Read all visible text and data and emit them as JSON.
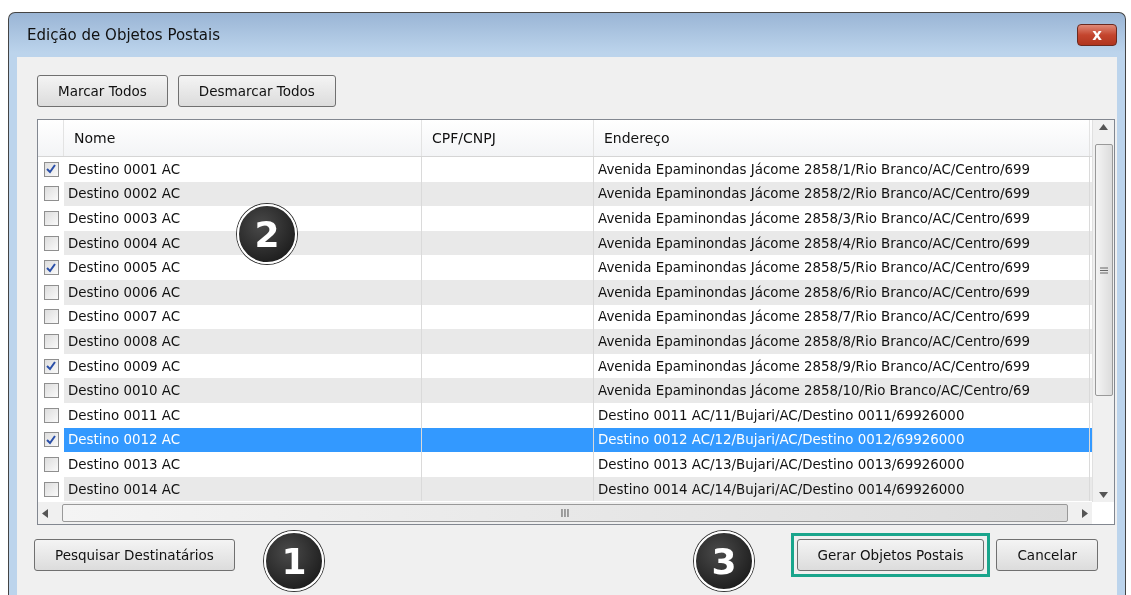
{
  "window": {
    "title": "Edição de Objetos Postais",
    "close_label": "x"
  },
  "top_buttons": [
    "Marcar Todos",
    "Desmarcar Todos"
  ],
  "table": {
    "columns": [
      "Nome",
      "CPF/CNPJ",
      "Endereço"
    ],
    "rows": [
      {
        "checked": true,
        "selected": false,
        "nome": "Destino 0001 AC",
        "cpf": "",
        "endereco": "Avenida Epaminondas Jácome 2858/1/Rio Branco/AC/Centro/699"
      },
      {
        "checked": false,
        "selected": false,
        "nome": "Destino 0002 AC",
        "cpf": "",
        "endereco": "Avenida Epaminondas Jácome 2858/2/Rio Branco/AC/Centro/699"
      },
      {
        "checked": false,
        "selected": false,
        "nome": "Destino 0003 AC",
        "cpf": "",
        "endereco": "Avenida Epaminondas Jácome 2858/3/Rio Branco/AC/Centro/699"
      },
      {
        "checked": false,
        "selected": false,
        "nome": "Destino 0004 AC",
        "cpf": "",
        "endereco": "Avenida Epaminondas Jácome 2858/4/Rio Branco/AC/Centro/699"
      },
      {
        "checked": true,
        "selected": false,
        "nome": "Destino 0005 AC",
        "cpf": "",
        "endereco": "Avenida Epaminondas Jácome 2858/5/Rio Branco/AC/Centro/699"
      },
      {
        "checked": false,
        "selected": false,
        "nome": "Destino 0006 AC",
        "cpf": "",
        "endereco": "Avenida Epaminondas Jácome 2858/6/Rio Branco/AC/Centro/699"
      },
      {
        "checked": false,
        "selected": false,
        "nome": "Destino 0007 AC",
        "cpf": "",
        "endereco": "Avenida Epaminondas Jácome 2858/7/Rio Branco/AC/Centro/699"
      },
      {
        "checked": false,
        "selected": false,
        "nome": "Destino 0008 AC",
        "cpf": "",
        "endereco": "Avenida Epaminondas Jácome 2858/8/Rio Branco/AC/Centro/699"
      },
      {
        "checked": true,
        "selected": false,
        "nome": "Destino 0009 AC",
        "cpf": "",
        "endereco": "Avenida Epaminondas Jácome 2858/9/Rio Branco/AC/Centro/699"
      },
      {
        "checked": false,
        "selected": false,
        "nome": "Destino 0010 AC",
        "cpf": "",
        "endereco": "Avenida Epaminondas Jácome 2858/10/Rio Branco/AC/Centro/69"
      },
      {
        "checked": false,
        "selected": false,
        "nome": "Destino 0011 AC",
        "cpf": "",
        "endereco": "Destino 0011 AC/11/Bujari/AC/Destino 0011/69926000"
      },
      {
        "checked": true,
        "selected": true,
        "nome": "Destino 0012 AC",
        "cpf": "",
        "endereco": "Destino 0012 AC/12/Bujari/AC/Destino 0012/69926000"
      },
      {
        "checked": false,
        "selected": false,
        "nome": "Destino 0013 AC",
        "cpf": "",
        "endereco": "Destino 0013 AC/13/Bujari/AC/Destino 0013/69926000"
      },
      {
        "checked": false,
        "selected": false,
        "nome": "Destino 0014 AC",
        "cpf": "",
        "endereco": "Destino 0014 AC/14/Bujari/AC/Destino 0014/69926000"
      }
    ],
    "hscroll_grip": "III"
  },
  "bottom_buttons": [
    {
      "label": "Pesquisar Destinatários",
      "highlighted": false
    },
    {
      "label": "Gerar Objetos Postais",
      "highlighted": true
    },
    {
      "label": "Cancelar",
      "highlighted": false
    }
  ],
  "annotations": [
    {
      "label": "2"
    },
    {
      "label": "1"
    },
    {
      "label": "3"
    }
  ]
}
